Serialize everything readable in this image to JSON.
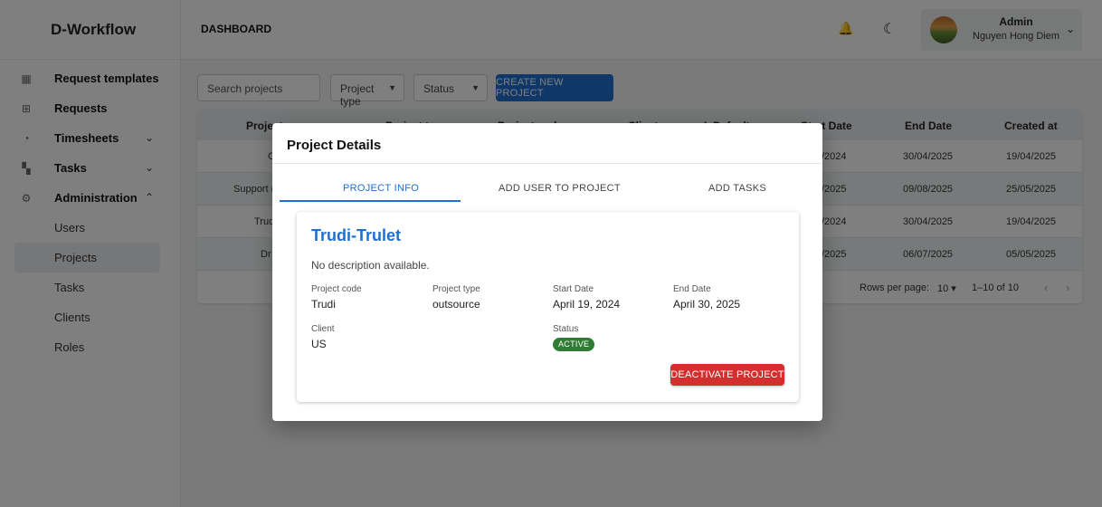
{
  "app": {
    "brand": "D-Workflow"
  },
  "sidebar": {
    "items": [
      {
        "label": "Request templates",
        "icon": "template-grid-icon"
      },
      {
        "label": "Requests",
        "icon": "table-icon"
      },
      {
        "label": "Timesheets",
        "icon": "timer-icon",
        "chevron": "⌄"
      },
      {
        "label": "Tasks",
        "icon": "tasks-icon",
        "chevron": "⌄"
      },
      {
        "label": "Administration",
        "icon": "admin-icon",
        "chevron": "⌃"
      }
    ],
    "subitems": [
      "Users",
      "Projects",
      "Tasks",
      "Clients",
      "Roles"
    ],
    "active_subitem": "Projects"
  },
  "topbar": {
    "title": "DASHBOARD",
    "user": {
      "name": "Admin",
      "fullname": "Nguyen Hong Diem"
    }
  },
  "toolbar": {
    "search_placeholder": "Search projects",
    "project_type_label": "Project type",
    "status_label": "Status",
    "create_label": "CREATE NEW PROJECT"
  },
  "table": {
    "headers": [
      "Project name",
      "Project type",
      "Project code",
      "Client",
      "IsDefault",
      "Start Date",
      "End Date",
      "Created at"
    ],
    "rows": [
      {
        "name": "C",
        "start": "/2024",
        "end": "30/04/2025",
        "created": "19/04/2025"
      },
      {
        "name": "Support (",
        "start": "/2025",
        "end": "09/08/2025",
        "created": "25/05/2025"
      },
      {
        "name": "Trud",
        "start": "/2024",
        "end": "30/04/2025",
        "created": "19/04/2025"
      },
      {
        "name": "Dr",
        "start": "/2025",
        "end": "06/07/2025",
        "created": "05/05/2025"
      }
    ],
    "footer": {
      "rows_per_page_label": "Rows per page:",
      "rows_per_page": "10",
      "range": "1–10 of 10"
    }
  },
  "modal": {
    "title": "Project Details",
    "tabs": [
      "PROJECT INFO",
      "ADD USER TO PROJECT",
      "ADD TASKS"
    ],
    "project": {
      "name": "Trudi-Trulet",
      "description": "No description available.",
      "code_label": "Project code",
      "code": "Trudi",
      "type_label": "Project type",
      "type": "outsource",
      "start_label": "Start Date",
      "start": "April 19, 2024",
      "end_label": "End Date",
      "end": "April 30, 2025",
      "client_label": "Client",
      "client": "US",
      "status_label": "Status",
      "status": "ACTIVE"
    },
    "deactivate_label": "DEACTIVATE PROJECT"
  },
  "colors": {
    "primary": "#1f6fd0",
    "danger": "#d32f2f",
    "success": "#2e7d32"
  }
}
